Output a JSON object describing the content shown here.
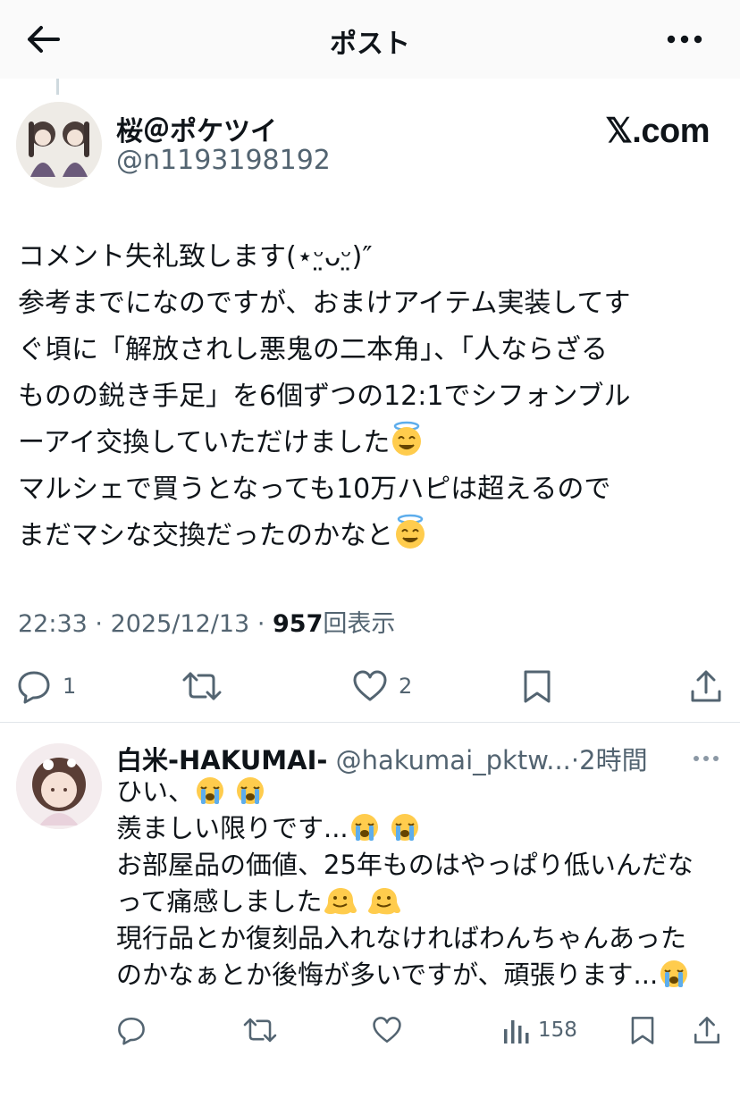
{
  "header": {
    "title": "ポスト"
  },
  "post": {
    "author_name": "桜＠ポケツイ",
    "author_handle": "@n1193198192",
    "brand": "𝕏.com",
    "text_lines": [
      "コメント失礼致します(⋆ᵕ̤ᴗᵕ̤)″",
      "参考までになのですが、おまけアイテム実装してす",
      "ぐ頃に「解放されし悪鬼の二本角」、「人ならざる",
      "ものの鋭き手足」を6個ずつの12:1でシフォンブル",
      "ーアイ交換していただけました",
      "マルシェで買うとなっても10万ハピは超えるので",
      "まだマシな交換だったのかなと"
    ],
    "time": "22:33",
    "date": "2025/12/13",
    "separator": "·",
    "views_count": "957",
    "views_label": "回表示",
    "reply_count": "1",
    "like_count": "2"
  },
  "reply": {
    "name": "白米-HAKUMAI-",
    "handle": "@hakumai_pktw...",
    "time": "2時間",
    "separator": "·",
    "text_lines": [
      "ひい、",
      "羨ましい限りです...",
      "お部屋品の価値、25年ものはやっぱり低いんだな",
      "って痛感しました",
      "現行品とか復刻品入れなければわんちゃんあった",
      "のかなぁとか後悔が多いですが、頑張ります..."
    ],
    "views_count": "158"
  },
  "icons": {
    "back": "arrow-left-icon",
    "more": "more-horizontal-icon",
    "reply": "comment-icon",
    "repost": "repost-icon",
    "like": "heart-icon",
    "bookmark": "bookmark-icon",
    "share": "share-icon",
    "views": "bar-chart-icon",
    "emoji_angel": "smiling-face-with-halo-emoji",
    "emoji_cry": "loudly-crying-face-emoji",
    "emoji_melt": "melting-face-emoji"
  },
  "colors": {
    "text": "#0f1419",
    "secondary": "#536471",
    "divider": "#e1e6ea",
    "emoji_yellow": "#ffcc4d"
  }
}
